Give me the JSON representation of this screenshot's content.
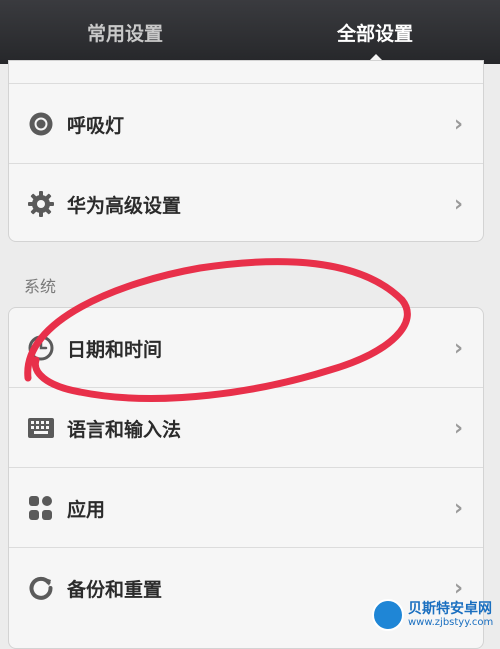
{
  "tabs": {
    "common_label": "常用设置",
    "all_label": "全部设置"
  },
  "top_group": {
    "items": [
      {
        "label": "呼吸灯",
        "icon": "breathing-light-icon"
      },
      {
        "label": "华为高级设置",
        "icon": "gear-icon"
      }
    ]
  },
  "system_section": {
    "title": "系统",
    "items": [
      {
        "label": "日期和时间",
        "icon": "clock-icon"
      },
      {
        "label": "语言和输入法",
        "icon": "keyboard-icon"
      },
      {
        "label": "应用",
        "icon": "apps-icon"
      },
      {
        "label": "备份和重置",
        "icon": "backup-icon"
      }
    ]
  },
  "chevron_glyph": "›",
  "watermark": {
    "title": "贝斯特安卓网",
    "url": "www.zjbstyy.com"
  },
  "colors": {
    "tabbar": "#2e2f33",
    "annotation": "#e8304a",
    "card_bg": "#f6f6f6"
  }
}
